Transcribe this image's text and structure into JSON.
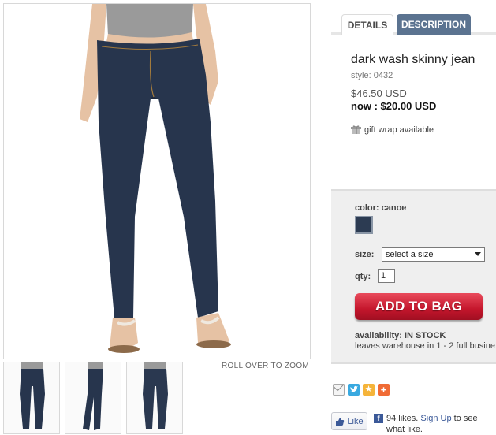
{
  "gallery": {
    "roll_over_label": "ROLL OVER TO ZOOM",
    "thumbnails": [
      {
        "view": "front"
      },
      {
        "view": "side"
      },
      {
        "view": "back"
      }
    ]
  },
  "tabs": [
    {
      "label": "DETAILS",
      "active": true
    },
    {
      "label": "DESCRIPTION",
      "active": false
    }
  ],
  "product": {
    "title": "dark wash skinny jean",
    "style_line": "style: 0432",
    "old_price": "$46.50 USD",
    "now_price": "now : $20.00 USD",
    "gift_wrap": "gift wrap available"
  },
  "options": {
    "color_label": "color: canoe",
    "swatch_color": "#2c3b52",
    "size_label": "size:",
    "size_selected": "select a size",
    "qty_label": "qty:",
    "qty_value": "1",
    "add_to_bag": "ADD TO BAG",
    "availability_label": "availability:",
    "availability_value": "IN STOCK",
    "leaves_warehouse": "leaves warehouse in 1 - 2 full busine"
  },
  "social": {
    "icons": [
      "mail-icon",
      "twitter-icon",
      "favorite-star-icon",
      "share-plus-icon"
    ],
    "like_button": "Like",
    "likes_count_text": "94 likes.",
    "sign_up_link": "Sign Up",
    "sign_up_suffix": "to see what",
    "wrap_text": "like."
  },
  "colors": {
    "description_tab": "#5b7390",
    "add_to_bag": "#c4162c",
    "facebook": "#3b5998"
  }
}
